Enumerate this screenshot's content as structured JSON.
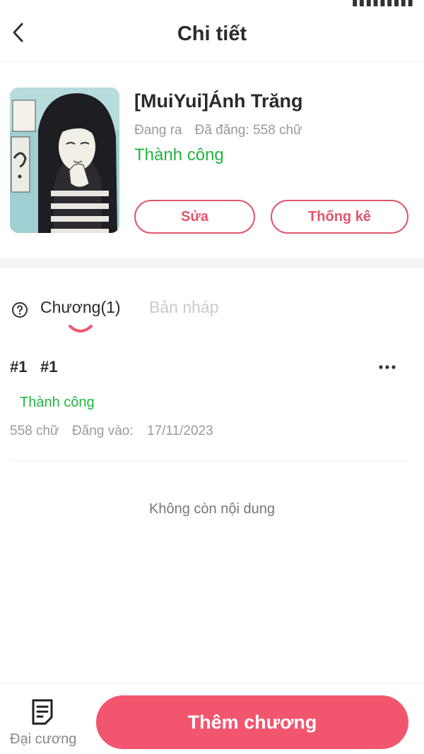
{
  "header": {
    "title": "Chi tiết",
    "back_icon": "chevron-left-icon"
  },
  "book": {
    "title": "[MuiYui]Ánh Trăng",
    "status": "Đang ra",
    "posted": "Đã đăng: 558 chữ",
    "state": "Thành công",
    "edit_label": "Sửa",
    "stats_label": "Thống kê"
  },
  "tabs": {
    "help_icon": "question-circle-icon",
    "items": [
      {
        "label": "Chương(1)",
        "active": true
      },
      {
        "label": "Bản nháp",
        "active": false
      }
    ]
  },
  "chapters": [
    {
      "number": "#1",
      "title": "#1",
      "state": "Thành công",
      "words": "558 chữ",
      "date_label": "Đăng vào:",
      "date": "17/11/2023"
    }
  ],
  "empty_note": "Không còn nội dung",
  "bottom": {
    "outline_label": "Đại cương",
    "outline_icon": "document-list-icon",
    "add_chapter_label": "Thêm chương"
  },
  "colors": {
    "accent": "#f2566f",
    "outline_accent": "#e0566e",
    "success": "#21b53f",
    "muted": "#9a9a9a"
  }
}
